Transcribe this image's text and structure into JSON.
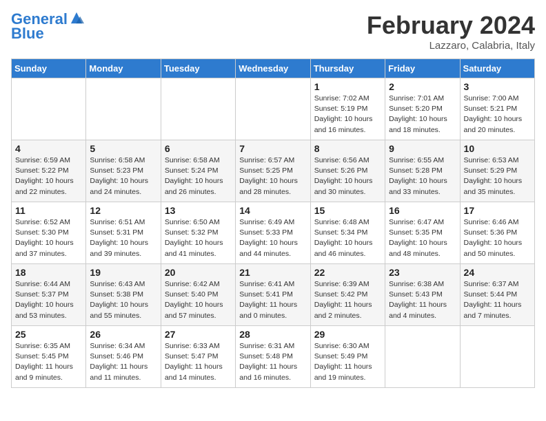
{
  "header": {
    "logo_line1": "General",
    "logo_line2": "Blue",
    "month_title": "February 2024",
    "location": "Lazzaro, Calabria, Italy"
  },
  "days_of_week": [
    "Sunday",
    "Monday",
    "Tuesday",
    "Wednesday",
    "Thursday",
    "Friday",
    "Saturday"
  ],
  "weeks": [
    [
      {
        "day": "",
        "info": ""
      },
      {
        "day": "",
        "info": ""
      },
      {
        "day": "",
        "info": ""
      },
      {
        "day": "",
        "info": ""
      },
      {
        "day": "1",
        "info": "Sunrise: 7:02 AM\nSunset: 5:19 PM\nDaylight: 10 hours\nand 16 minutes."
      },
      {
        "day": "2",
        "info": "Sunrise: 7:01 AM\nSunset: 5:20 PM\nDaylight: 10 hours\nand 18 minutes."
      },
      {
        "day": "3",
        "info": "Sunrise: 7:00 AM\nSunset: 5:21 PM\nDaylight: 10 hours\nand 20 minutes."
      }
    ],
    [
      {
        "day": "4",
        "info": "Sunrise: 6:59 AM\nSunset: 5:22 PM\nDaylight: 10 hours\nand 22 minutes."
      },
      {
        "day": "5",
        "info": "Sunrise: 6:58 AM\nSunset: 5:23 PM\nDaylight: 10 hours\nand 24 minutes."
      },
      {
        "day": "6",
        "info": "Sunrise: 6:58 AM\nSunset: 5:24 PM\nDaylight: 10 hours\nand 26 minutes."
      },
      {
        "day": "7",
        "info": "Sunrise: 6:57 AM\nSunset: 5:25 PM\nDaylight: 10 hours\nand 28 minutes."
      },
      {
        "day": "8",
        "info": "Sunrise: 6:56 AM\nSunset: 5:26 PM\nDaylight: 10 hours\nand 30 minutes."
      },
      {
        "day": "9",
        "info": "Sunrise: 6:55 AM\nSunset: 5:28 PM\nDaylight: 10 hours\nand 33 minutes."
      },
      {
        "day": "10",
        "info": "Sunrise: 6:53 AM\nSunset: 5:29 PM\nDaylight: 10 hours\nand 35 minutes."
      }
    ],
    [
      {
        "day": "11",
        "info": "Sunrise: 6:52 AM\nSunset: 5:30 PM\nDaylight: 10 hours\nand 37 minutes."
      },
      {
        "day": "12",
        "info": "Sunrise: 6:51 AM\nSunset: 5:31 PM\nDaylight: 10 hours\nand 39 minutes."
      },
      {
        "day": "13",
        "info": "Sunrise: 6:50 AM\nSunset: 5:32 PM\nDaylight: 10 hours\nand 41 minutes."
      },
      {
        "day": "14",
        "info": "Sunrise: 6:49 AM\nSunset: 5:33 PM\nDaylight: 10 hours\nand 44 minutes."
      },
      {
        "day": "15",
        "info": "Sunrise: 6:48 AM\nSunset: 5:34 PM\nDaylight: 10 hours\nand 46 minutes."
      },
      {
        "day": "16",
        "info": "Sunrise: 6:47 AM\nSunset: 5:35 PM\nDaylight: 10 hours\nand 48 minutes."
      },
      {
        "day": "17",
        "info": "Sunrise: 6:46 AM\nSunset: 5:36 PM\nDaylight: 10 hours\nand 50 minutes."
      }
    ],
    [
      {
        "day": "18",
        "info": "Sunrise: 6:44 AM\nSunset: 5:37 PM\nDaylight: 10 hours\nand 53 minutes."
      },
      {
        "day": "19",
        "info": "Sunrise: 6:43 AM\nSunset: 5:38 PM\nDaylight: 10 hours\nand 55 minutes."
      },
      {
        "day": "20",
        "info": "Sunrise: 6:42 AM\nSunset: 5:40 PM\nDaylight: 10 hours\nand 57 minutes."
      },
      {
        "day": "21",
        "info": "Sunrise: 6:41 AM\nSunset: 5:41 PM\nDaylight: 11 hours\nand 0 minutes."
      },
      {
        "day": "22",
        "info": "Sunrise: 6:39 AM\nSunset: 5:42 PM\nDaylight: 11 hours\nand 2 minutes."
      },
      {
        "day": "23",
        "info": "Sunrise: 6:38 AM\nSunset: 5:43 PM\nDaylight: 11 hours\nand 4 minutes."
      },
      {
        "day": "24",
        "info": "Sunrise: 6:37 AM\nSunset: 5:44 PM\nDaylight: 11 hours\nand 7 minutes."
      }
    ],
    [
      {
        "day": "25",
        "info": "Sunrise: 6:35 AM\nSunset: 5:45 PM\nDaylight: 11 hours\nand 9 minutes."
      },
      {
        "day": "26",
        "info": "Sunrise: 6:34 AM\nSunset: 5:46 PM\nDaylight: 11 hours\nand 11 minutes."
      },
      {
        "day": "27",
        "info": "Sunrise: 6:33 AM\nSunset: 5:47 PM\nDaylight: 11 hours\nand 14 minutes."
      },
      {
        "day": "28",
        "info": "Sunrise: 6:31 AM\nSunset: 5:48 PM\nDaylight: 11 hours\nand 16 minutes."
      },
      {
        "day": "29",
        "info": "Sunrise: 6:30 AM\nSunset: 5:49 PM\nDaylight: 11 hours\nand 19 minutes."
      },
      {
        "day": "",
        "info": ""
      },
      {
        "day": "",
        "info": ""
      }
    ]
  ]
}
